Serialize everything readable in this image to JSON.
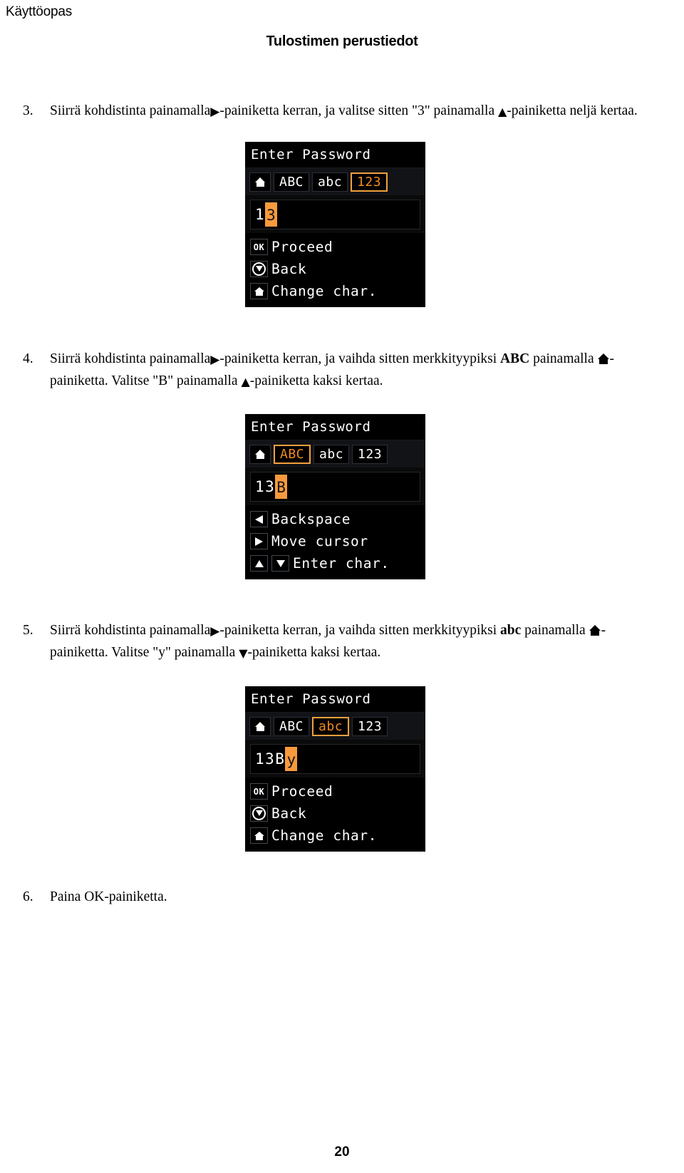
{
  "header": {
    "running_head": "Käyttöopas",
    "section_title": "Tulostimen perustiedot"
  },
  "steps": [
    {
      "number": "3.",
      "text_1": "Siirrä kohdistinta painamalla",
      "icon_1": "right-arrow-key-icon",
      "text_2": "-painiketta kerran, ja valitse sitten \"3\" painamalla",
      "icon_2": "up-arrow-key-icon",
      "text_3": "-painiketta neljä kertaa."
    },
    {
      "number": "4.",
      "text_1": "Siirrä kohdistinta painamalla",
      "icon_1": "right-arrow-key-icon",
      "text_2": "-painiketta kerran, ja vaihda sitten merkkityypiksi",
      "bold_1": "ABC",
      "text_3": "painamalla",
      "icon_2": "home-key-icon",
      "text_4": "-painiketta. Valitse \"B\" painamalla",
      "icon_3": "up-arrow-key-icon",
      "text_5": "-painiketta kaksi kertaa."
    },
    {
      "number": "5.",
      "text_1": "Siirrä kohdistinta painamalla",
      "icon_1": "right-arrow-key-icon",
      "text_2": "-painiketta kerran, ja vaihda sitten merkkityypiksi",
      "bold_1": "abc",
      "text_3": "painamalla",
      "icon_2": "home-key-icon",
      "text_4": "-painiketta. Valitse \"y\" painamalla",
      "icon_3": "down-arrow-key-icon",
      "text_5": "-painiketta kaksi kertaa."
    },
    {
      "number": "6.",
      "text_1": "Paina OK-painiketta."
    }
  ],
  "lcd_screens": [
    {
      "title": "Enter Password",
      "modes": [
        {
          "label": "ABC",
          "selected": false
        },
        {
          "label": "abc",
          "selected": false
        },
        {
          "label": "123",
          "selected": true
        }
      ],
      "input_text": "1",
      "input_cursor_char": "3",
      "actions": [
        {
          "key": "OK",
          "key_icon": "ok-key-icon",
          "label": "Proceed"
        },
        {
          "key": "",
          "key_icon": "back-key-icon",
          "label": "Back"
        },
        {
          "key": "",
          "key_icon": "home-key-icon",
          "label": "Change char."
        }
      ]
    },
    {
      "title": "Enter Password",
      "modes": [
        {
          "label": "ABC",
          "selected": true
        },
        {
          "label": "abc",
          "selected": false
        },
        {
          "label": "123",
          "selected": false
        }
      ],
      "input_text": "13",
      "input_cursor_char": "B",
      "actions": [
        {
          "key": "",
          "key_icon": "left-arrow-key-icon",
          "label": "Backspace"
        },
        {
          "key": "",
          "key_icon": "right-arrow-key-icon",
          "label": "Move cursor"
        },
        {
          "key": "",
          "key_icon": "up-down-arrow-key-icon",
          "label": "Enter char."
        }
      ]
    },
    {
      "title": "Enter Password",
      "modes": [
        {
          "label": "ABC",
          "selected": false
        },
        {
          "label": "abc",
          "selected": true
        },
        {
          "label": "123",
          "selected": false
        }
      ],
      "input_text": "13B",
      "input_cursor_char": "y",
      "actions": [
        {
          "key": "OK",
          "key_icon": "ok-key-icon",
          "label": "Proceed"
        },
        {
          "key": "",
          "key_icon": "back-key-icon",
          "label": "Back"
        },
        {
          "key": "",
          "key_icon": "home-key-icon",
          "label": "Change char."
        }
      ]
    }
  ],
  "footer": {
    "page_number": "20"
  },
  "colors": {
    "accent_orange": "#f79a3d",
    "selected_text_orange": "#f08a20",
    "lcd_background": "#0a0a0a",
    "lcd_mode_bar": "#121317"
  }
}
